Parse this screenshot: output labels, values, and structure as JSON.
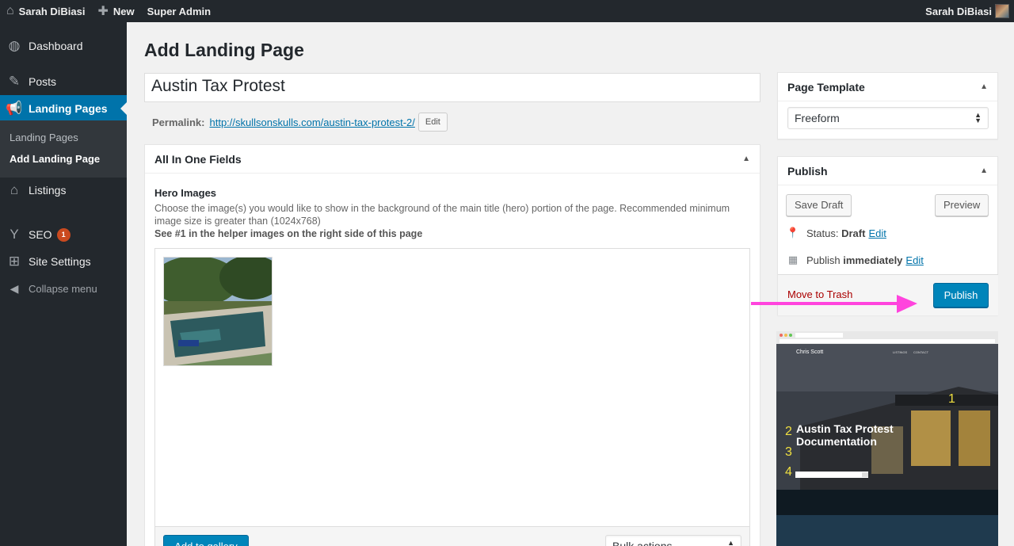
{
  "adminbar": {
    "site_name": "Sarah DiBiasi",
    "new_label": "New",
    "super_admin": "Super Admin",
    "user_name": "Sarah DiBiasi"
  },
  "sidebar": {
    "items": [
      {
        "label": "Dashboard",
        "icon": "dashboard-icon"
      },
      {
        "label": "Posts",
        "icon": "pushpin-icon"
      },
      {
        "label": "Landing Pages",
        "icon": "megaphone-icon"
      },
      {
        "label": "Listings",
        "icon": "home-icon"
      },
      {
        "label": "SEO",
        "icon": "yoast-icon",
        "badge": "1"
      },
      {
        "label": "Site Settings",
        "icon": "settings-grid-icon"
      }
    ],
    "submenu": [
      "Landing Pages",
      "Add Landing Page"
    ],
    "collapse": "Collapse menu"
  },
  "main": {
    "page_title": "Add Landing Page",
    "post_title": "Austin Tax Protest",
    "permalink_label": "Permalink:",
    "permalink_url": "http://skullsonskulls.com/austin-tax-protest-2/",
    "permalink_edit": "Edit",
    "box_title": "All In One Fields",
    "hero_label": "Hero Images",
    "hero_desc": "Choose the image(s) you would like to show in the background of the main title (hero) portion of the page. Recommended minimum image size is greater than (1024x768)",
    "hero_note": "See #1 in the helper images on the right side of this page",
    "add_gallery": "Add to gallery",
    "bulk_actions": "Bulk actions"
  },
  "page_template": {
    "title": "Page Template",
    "selected": "Freeform"
  },
  "publish": {
    "title": "Publish",
    "save_draft": "Save Draft",
    "preview": "Preview",
    "status_label": "Status:",
    "status_value": "Draft",
    "status_edit": "Edit",
    "publish_label": "Publish",
    "publish_when": "immediately",
    "publish_edit": "Edit",
    "trash": "Move to Trash",
    "publish_button": "Publish"
  },
  "helper": {
    "brand": "Chris Scott",
    "nav": [
      "LISTINGS",
      "CONTACT"
    ],
    "heading_line1": "Austin Tax Protest",
    "heading_line2": "Documentation",
    "markers": [
      "1",
      "2",
      "3",
      "4"
    ]
  },
  "colors": {
    "accent": "#0073aa",
    "arrow": "#ff44dd",
    "trash": "#a00000"
  }
}
